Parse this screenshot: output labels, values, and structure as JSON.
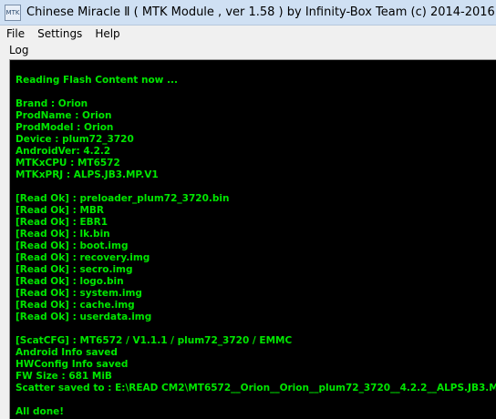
{
  "window": {
    "title": "Chinese Miracle Ⅱ ( MTK Module , ver 1.58 ) by Infinity-Box Team (c) 2014-2016",
    "icon_text": "MTK"
  },
  "menu": {
    "items": [
      "File",
      "Settings",
      "Help"
    ]
  },
  "tabs": {
    "log_label": "Log"
  },
  "log": {
    "lines": [
      "Reading Flash Content now ...",
      "Brand     : Orion",
      "ProdName  : Orion",
      "ProdModel : Orion",
      "Device    : plum72_3720",
      "AndroidVer: 4.2.2",
      "MTKxCPU   : MT6572",
      "MTKxPRJ   : ALPS.JB3.MP.V1",
      "[Read Ok] : preloader_plum72_3720.bin",
      "[Read Ok] : MBR",
      "[Read Ok] : EBR1",
      "[Read Ok] : lk.bin",
      "[Read Ok] : boot.img",
      "[Read Ok] : recovery.img",
      "[Read Ok] : secro.img",
      "[Read Ok] : logo.bin",
      "[Read Ok] : system.img",
      "[Read Ok] : cache.img",
      "[Read Ok] : userdata.img",
      "[ScatCFG] : MT6572 / V1.1.1 / plum72_3720 / EMMC",
      "Android Info saved",
      "HWConfig Info saved",
      "FW Size : 681 MiB",
      "Scatter saved to : E:\\READ CM2\\MT6572__Orion__Orion__plum72_3720__4.2.2__ALPS.JB3.M",
      "All done!"
    ],
    "text_color": "#00e600",
    "background": "#000000"
  }
}
